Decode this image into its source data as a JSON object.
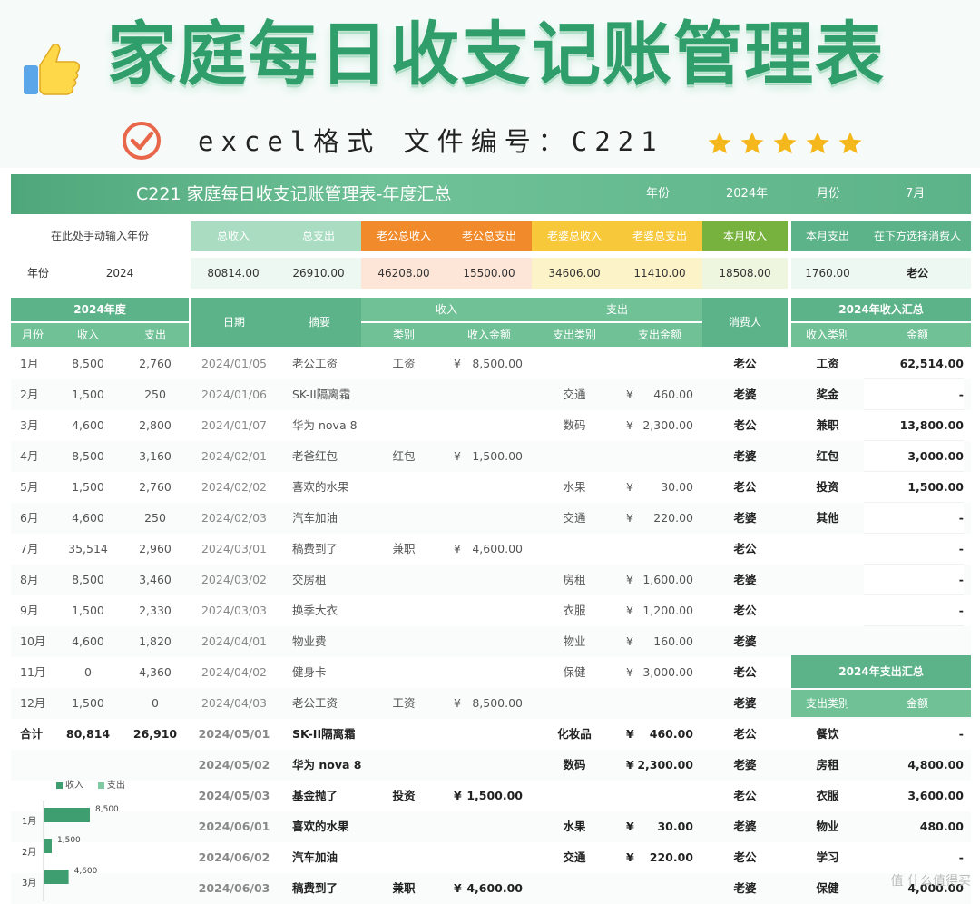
{
  "banner": {
    "title": "家庭每日收支记账管理表",
    "subtitle": "excel格式  文件编号：C221",
    "rating_stars": 5,
    "colors": {
      "title": "#2f9e6a",
      "star": "#f5b81c",
      "check": "#e8664a"
    }
  },
  "sheet_title": {
    "main": "C221 家庭每日收支记账管理表-年度汇总",
    "year_label": "年份",
    "year_value": "2024年",
    "month_label": "月份",
    "month_value": "7月"
  },
  "summary": {
    "input_hint": "在此处手动输入年份",
    "year_label": "年份",
    "year_value": "2024",
    "headers": [
      "总收入",
      "总支出",
      "老公总收入",
      "老公总支出",
      "老婆总收入",
      "老婆总支出",
      "本月收入",
      "本月支出",
      "在下方选择消费人"
    ],
    "values": [
      "80814.00",
      "26910.00",
      "46208.00",
      "15500.00",
      "34606.00",
      "11410.00",
      "18508.00",
      "1760.00",
      "老公"
    ]
  },
  "yearly": {
    "header": "2024年度",
    "cols": [
      "月份",
      "收入",
      "支出"
    ],
    "rows": [
      [
        "1月",
        "8,500",
        "2,760"
      ],
      [
        "2月",
        "1,500",
        "250"
      ],
      [
        "3月",
        "4,600",
        "2,800"
      ],
      [
        "4月",
        "8,500",
        "3,160"
      ],
      [
        "5月",
        "1,500",
        "2,760"
      ],
      [
        "6月",
        "4,600",
        "250"
      ],
      [
        "7月",
        "35,514",
        "2,960"
      ],
      [
        "8月",
        "8,500",
        "3,460"
      ],
      [
        "9月",
        "1,500",
        "2,330"
      ],
      [
        "10月",
        "4,600",
        "1,820"
      ],
      [
        "11月",
        "0",
        "4,360"
      ],
      [
        "12月",
        "1,500",
        "0"
      ]
    ],
    "total": [
      "合计",
      "80,814",
      "26,910"
    ]
  },
  "ledger": {
    "headers": {
      "date": "日期",
      "summary": "摘要",
      "income": "收入",
      "expense": "支出",
      "income_type": "类别",
      "income_amount": "收入金额",
      "expense_type": "支出类别",
      "expense_amount": "支出金额",
      "person": "消费人"
    },
    "currency": "¥",
    "rows": [
      [
        "2024/01/05",
        "老公工资",
        "工资",
        "8,500.00",
        "",
        "",
        "老公"
      ],
      [
        "2024/01/06",
        "SK-II隔离霜",
        "",
        "",
        "交通",
        "460.00",
        "老婆"
      ],
      [
        "2024/01/07",
        "华为 nova 8",
        "",
        "",
        "数码",
        "2,300.00",
        "老公"
      ],
      [
        "2024/02/01",
        "老爸红包",
        "红包",
        "1,500.00",
        "",
        "",
        "老婆"
      ],
      [
        "2024/02/02",
        "喜欢的水果",
        "",
        "",
        "水果",
        "30.00",
        "老公"
      ],
      [
        "2024/02/03",
        "汽车加油",
        "",
        "",
        "交通",
        "220.00",
        "老婆"
      ],
      [
        "2024/03/01",
        "稿费到了",
        "兼职",
        "4,600.00",
        "",
        "",
        "老公"
      ],
      [
        "2024/03/02",
        "交房租",
        "",
        "",
        "房租",
        "1,600.00",
        "老婆"
      ],
      [
        "2024/03/03",
        "换季大衣",
        "",
        "",
        "衣服",
        "1,200.00",
        "老公"
      ],
      [
        "2024/04/01",
        "物业费",
        "",
        "",
        "物业",
        "160.00",
        "老婆"
      ],
      [
        "2024/04/02",
        "健身卡",
        "",
        "",
        "保健",
        "3,000.00",
        "老公"
      ],
      [
        "2024/04/03",
        "老公工资",
        "工资",
        "8,500.00",
        "",
        "",
        "老婆"
      ],
      [
        "2024/05/01",
        "SK-II隔离霜",
        "",
        "",
        "化妆品",
        "460.00",
        "老公"
      ],
      [
        "2024/05/02",
        "华为 nova 8",
        "",
        "",
        "数码",
        "2,300.00",
        "老婆"
      ],
      [
        "2024/05/03",
        "基金抛了",
        "投资",
        "1,500.00",
        "",
        "",
        "老公"
      ],
      [
        "2024/06/01",
        "喜欢的水果",
        "",
        "",
        "水果",
        "30.00",
        "老婆"
      ],
      [
        "2024/06/02",
        "汽车加油",
        "",
        "",
        "交通",
        "220.00",
        "老公"
      ],
      [
        "2024/06/03",
        "稿费到了",
        "兼职",
        "4,600.00",
        "",
        "",
        "老婆"
      ]
    ]
  },
  "income_summary": {
    "header": "2024年收入汇总",
    "cols": [
      "收入类别",
      "金额"
    ],
    "rows": [
      [
        "工资",
        "62,514.00"
      ],
      [
        "奖金",
        "-"
      ],
      [
        "兼职",
        "13,800.00"
      ],
      [
        "红包",
        "3,000.00"
      ],
      [
        "投资",
        "1,500.00"
      ],
      [
        "其他",
        "-"
      ],
      [
        "",
        "-"
      ],
      [
        "",
        "-"
      ],
      [
        "",
        "-"
      ]
    ]
  },
  "expense_summary": {
    "header": "2024年支出汇总",
    "cols": [
      "支出类别",
      "金额"
    ],
    "rows": [
      [
        "餐饮",
        "-"
      ],
      [
        "房租",
        "4,800.00"
      ],
      [
        "衣服",
        "3,600.00"
      ],
      [
        "物业",
        "480.00"
      ],
      [
        "学习",
        "-"
      ],
      [
        "保健",
        "4,000.00"
      ]
    ]
  },
  "chart_data": {
    "type": "bar",
    "orientation": "horizontal",
    "legend": [
      "收入",
      "支出"
    ],
    "categories": [
      "1月",
      "2月",
      "3月"
    ],
    "series": [
      {
        "name": "收入",
        "values": [
          8500,
          1500,
          4600
        ],
        "color": "#3f9e6f"
      },
      {
        "name": "支出",
        "values": [
          2760,
          250,
          2800
        ],
        "color": "#7fcaa2"
      }
    ],
    "data_labels": [
      "8,500",
      "1,500",
      "4,600"
    ]
  },
  "watermark": "值 什么值得买"
}
